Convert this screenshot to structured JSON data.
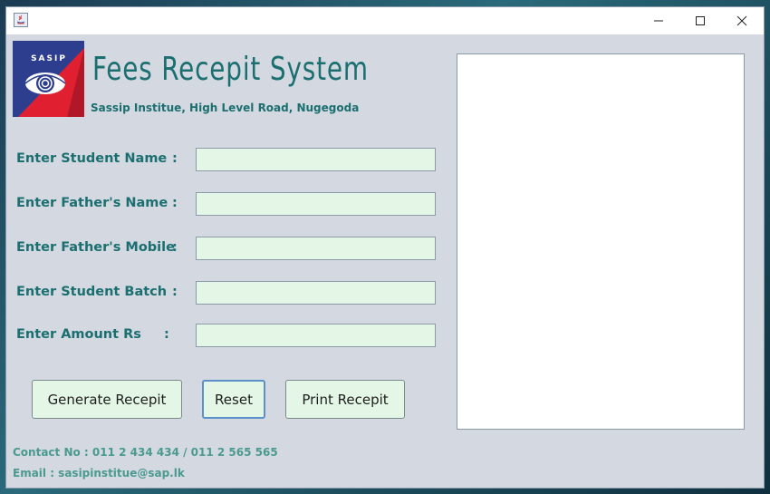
{
  "window": {
    "controls": {
      "minimize_icon": "minimize-icon",
      "maximize_icon": "maximize-icon",
      "close_icon": "close-icon"
    }
  },
  "header": {
    "logo_text": "SASIP",
    "title": "Fees Recepit System",
    "subtitle": "Sassip Institue, High Level Road, Nugegoda"
  },
  "form": {
    "fields": [
      {
        "label": "Enter Student Name",
        "colon": ":",
        "value": ""
      },
      {
        "label": "Enter Father's Name",
        "colon": ":",
        "value": ""
      },
      {
        "label": "Enter Father's Mobile",
        "colon": ":",
        "value": ""
      },
      {
        "label": "Enter Student Batch",
        "colon": ":",
        "value": ""
      },
      {
        "label": "Enter Amount Rs",
        "colon": ":",
        "value": ""
      }
    ]
  },
  "buttons": {
    "generate": "Generate Recepit",
    "reset": "Reset",
    "print": "Print Recepit"
  },
  "footer": {
    "contact": "Contact No : 011 2 434 434 / 011 2 565 565",
    "email": "Email : sasipinstitue@sap.lk"
  },
  "colors": {
    "accent": "#1b6f70",
    "field_bg": "#e4f7e6",
    "panel_bg": "#d4d8e0"
  }
}
